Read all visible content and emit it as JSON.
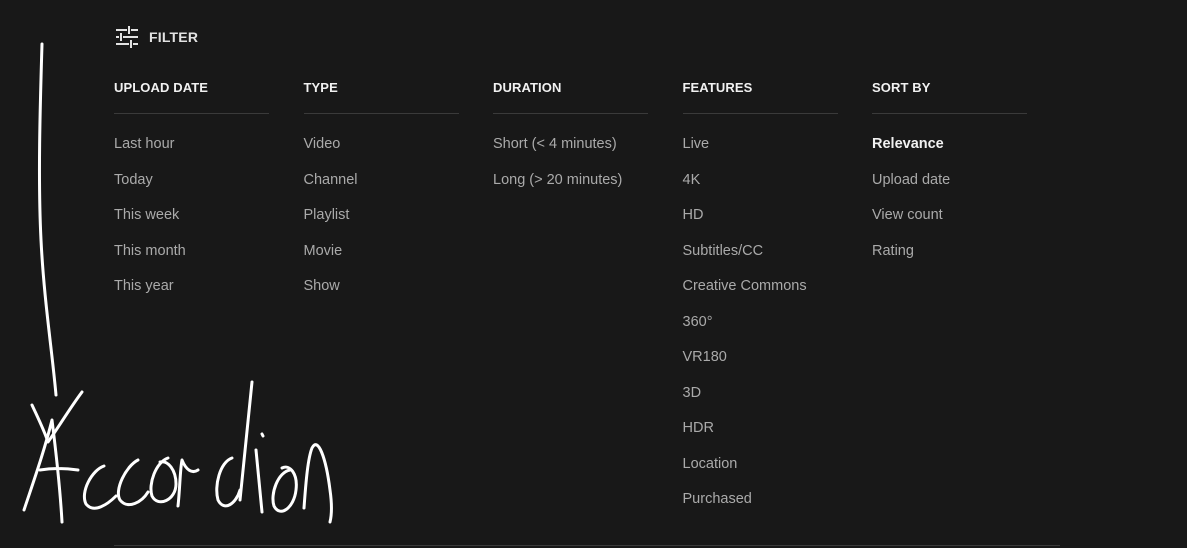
{
  "filter_toggle": {
    "label": "FILTER",
    "icon": "tune-icon"
  },
  "groups": [
    {
      "header": "UPLOAD DATE",
      "options": [
        "Last hour",
        "Today",
        "This week",
        "This month",
        "This year"
      ]
    },
    {
      "header": "TYPE",
      "options": [
        "Video",
        "Channel",
        "Playlist",
        "Movie",
        "Show"
      ]
    },
    {
      "header": "DURATION",
      "options": [
        "Short (< 4 minutes)",
        "Long (> 20 minutes)"
      ]
    },
    {
      "header": "FEATURES",
      "options": [
        "Live",
        "4K",
        "HD",
        "Subtitles/CC",
        "Creative Commons",
        "360°",
        "VR180",
        "3D",
        "HDR",
        "Location",
        "Purchased"
      ]
    },
    {
      "header": "SORT BY",
      "options": [
        "Relevance",
        "Upload date",
        "View count",
        "Rating"
      ],
      "selected": "Relevance"
    }
  ],
  "annotation": {
    "text": "Accordion",
    "icon": "arrow-down-icon"
  },
  "colors": {
    "background": "#181818",
    "header_text": "#f1f1f1",
    "option_text": "#aaaaaa",
    "divider": "#3a3a3a",
    "annotation_ink": "#ffffff"
  }
}
